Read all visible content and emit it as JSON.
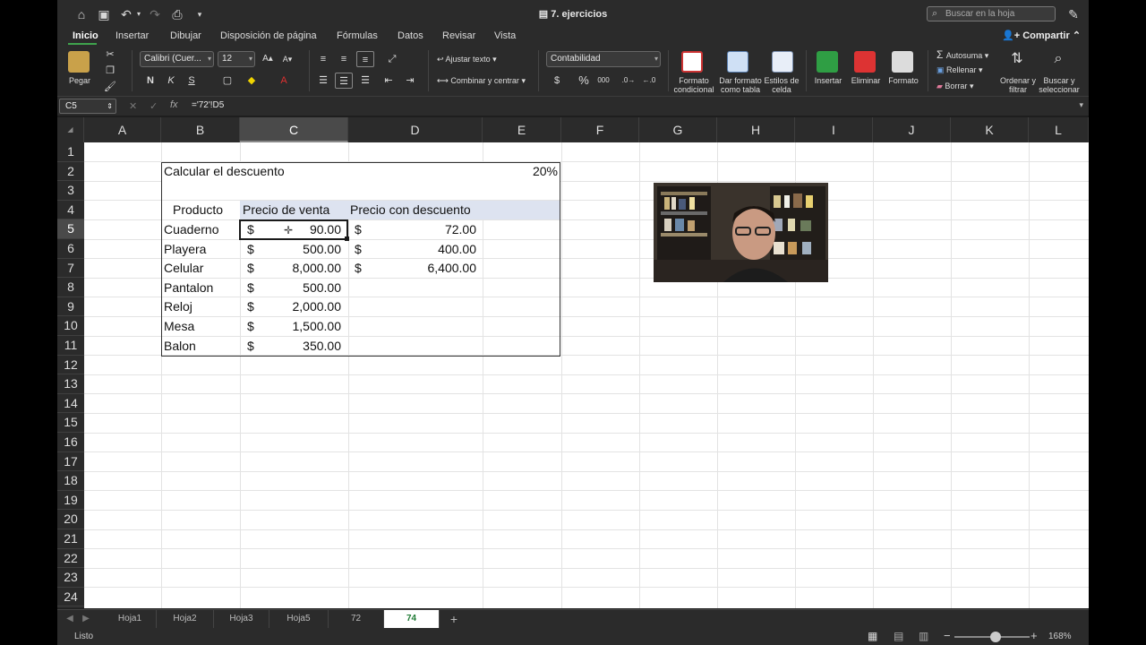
{
  "window": {
    "title": "7. ejercicios"
  },
  "search": {
    "placeholder": "Buscar en la hoja"
  },
  "tabs": [
    "Inicio",
    "Insertar",
    "Dibujar",
    "Disposición de página",
    "Fórmulas",
    "Datos",
    "Revisar",
    "Vista"
  ],
  "share_label": "Compartir",
  "ribbon": {
    "paste": "Pegar",
    "font_name": "Calibri (Cuer...",
    "font_size": "12",
    "bold": "N",
    "italic": "K",
    "underline": "S",
    "wrap_text": "Ajustar texto",
    "merge_center": "Combinar y centrar",
    "number_format": "Contabilidad",
    "currency": "$",
    "percent": "%",
    "thousands": "000",
    "cond_format": "Formato condicional",
    "table_format": "Dar formato como tabla",
    "cell_styles": "Estilos de celda",
    "insert": "Insertar",
    "delete": "Eliminar",
    "format": "Formato",
    "autosum": "Autosuma",
    "fill": "Rellenar",
    "clear": "Borrar",
    "sort_filter": "Ordenar y filtrar",
    "find_select": "Buscar y seleccionar"
  },
  "formula_bar": {
    "name_box": "C5",
    "fx": "fx",
    "formula": "='72'!D5"
  },
  "columns": [
    "A",
    "B",
    "C",
    "D",
    "E",
    "F",
    "G",
    "H",
    "I",
    "J",
    "K",
    "L"
  ],
  "rows": [
    "1",
    "2",
    "3",
    "4",
    "5",
    "6",
    "7",
    "8",
    "9",
    "10",
    "11",
    "12",
    "13",
    "14",
    "15",
    "16",
    "17",
    "18",
    "19",
    "20",
    "21",
    "22",
    "23",
    "24"
  ],
  "sheet": {
    "title": "Calcular el descuento",
    "discount": "20%",
    "headers": {
      "product": "Producto",
      "price": "Precio de venta",
      "discounted": "Precio con descuento"
    },
    "currency_symbol": "$",
    "items": [
      {
        "product": "Cuaderno",
        "price": "90.00",
        "discounted": "72.00"
      },
      {
        "product": "Playera",
        "price": "500.00",
        "discounted": "400.00"
      },
      {
        "product": "Celular",
        "price": "8,000.00",
        "discounted": "6,400.00"
      },
      {
        "product": "Pantalon",
        "price": "500.00",
        "discounted": ""
      },
      {
        "product": "Reloj",
        "price": "2,000.00",
        "discounted": ""
      },
      {
        "product": "Mesa",
        "price": "1,500.00",
        "discounted": ""
      },
      {
        "product": "Balon",
        "price": "350.00",
        "discounted": ""
      }
    ]
  },
  "sheet_tabs": [
    "Hoja1",
    "Hoja2",
    "Hoja3",
    "Hoja5",
    "72",
    "74"
  ],
  "active_sheet": "74",
  "status": {
    "text": "Listo",
    "zoom": "168%"
  },
  "colors": {
    "accent": "#3fa34d",
    "header_band": "#dde3f0"
  }
}
